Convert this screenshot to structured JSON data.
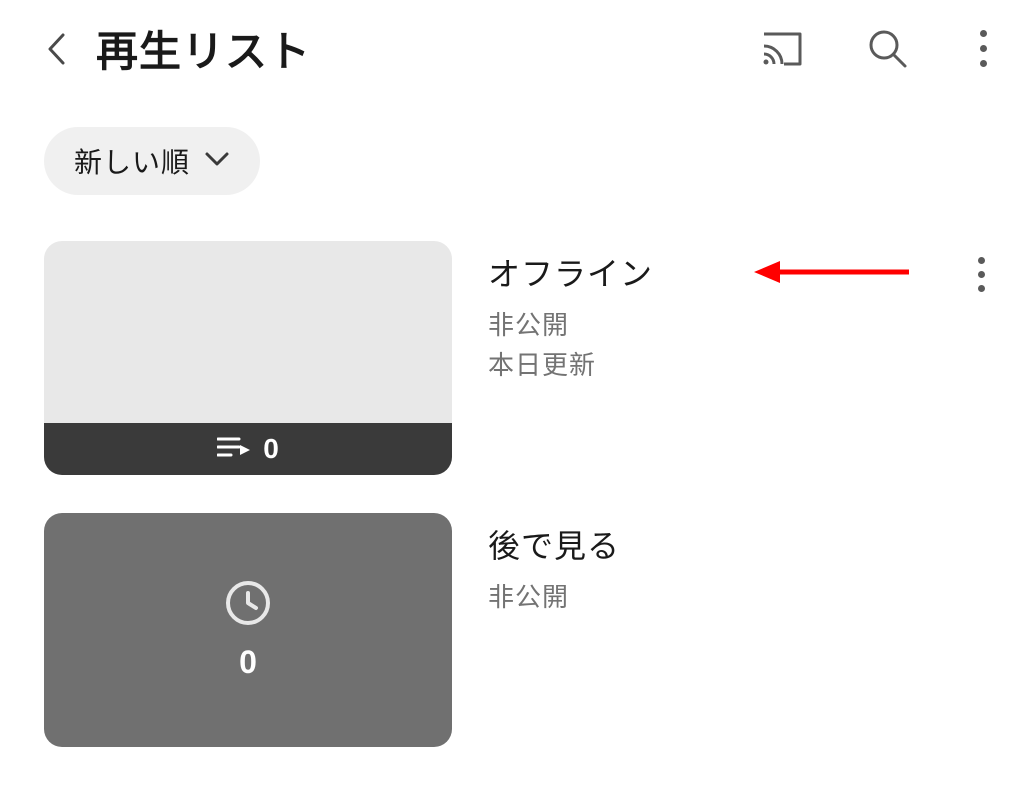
{
  "header": {
    "title": "再生リスト"
  },
  "sort": {
    "label": "新しい順"
  },
  "items": [
    {
      "title": "オフライン",
      "visibility": "非公開",
      "updated": "本日更新",
      "count": "0",
      "kind": "offline"
    },
    {
      "title": "後で見る",
      "visibility": "非公開",
      "count": "0",
      "kind": "watch_later"
    }
  ],
  "annotation": {
    "arrow_color": "#ff0000"
  }
}
